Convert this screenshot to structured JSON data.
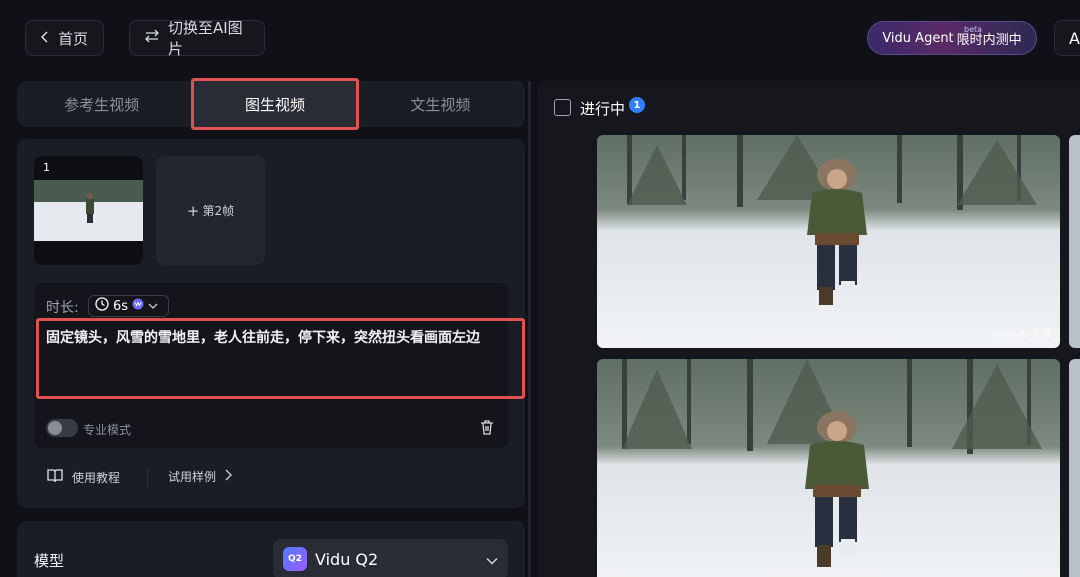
{
  "header": {
    "home_label": "首页",
    "switch_label": "切换至AI图片",
    "agent_label": "Vidu Agent",
    "agent_suffix": "限时内测中",
    "agent_beta": "beta",
    "right_btn_label": "A"
  },
  "tabs": [
    {
      "label": "参考生视频",
      "active": false
    },
    {
      "label": "图生视频",
      "active": true
    },
    {
      "label": "文生视频",
      "active": false
    }
  ],
  "frames": {
    "frame1_index": "1",
    "frame2_label": "第2帧"
  },
  "prompt": {
    "duration_label": "时长:",
    "duration_value": "6s",
    "text": "固定镜头，风雪的雪地里，老人往前走，停下来，突然扭头看画面左边",
    "pro_mode_label": "专业模式",
    "pro_mode_on": false
  },
  "links": {
    "tutorial_label": "使用教程",
    "examples_label": "试用样例"
  },
  "model": {
    "label": "模型",
    "value": "Vidu Q2",
    "badge": "Q2"
  },
  "results": {
    "inprogress_label": "进行中",
    "inprogress_count": "1",
    "watermark": "Vidu AI 生成"
  },
  "colors": {
    "accent_red": "#e0524f",
    "badge_blue": "#2f80ff",
    "background": "#0f1116",
    "panel": "#1b1d24"
  }
}
